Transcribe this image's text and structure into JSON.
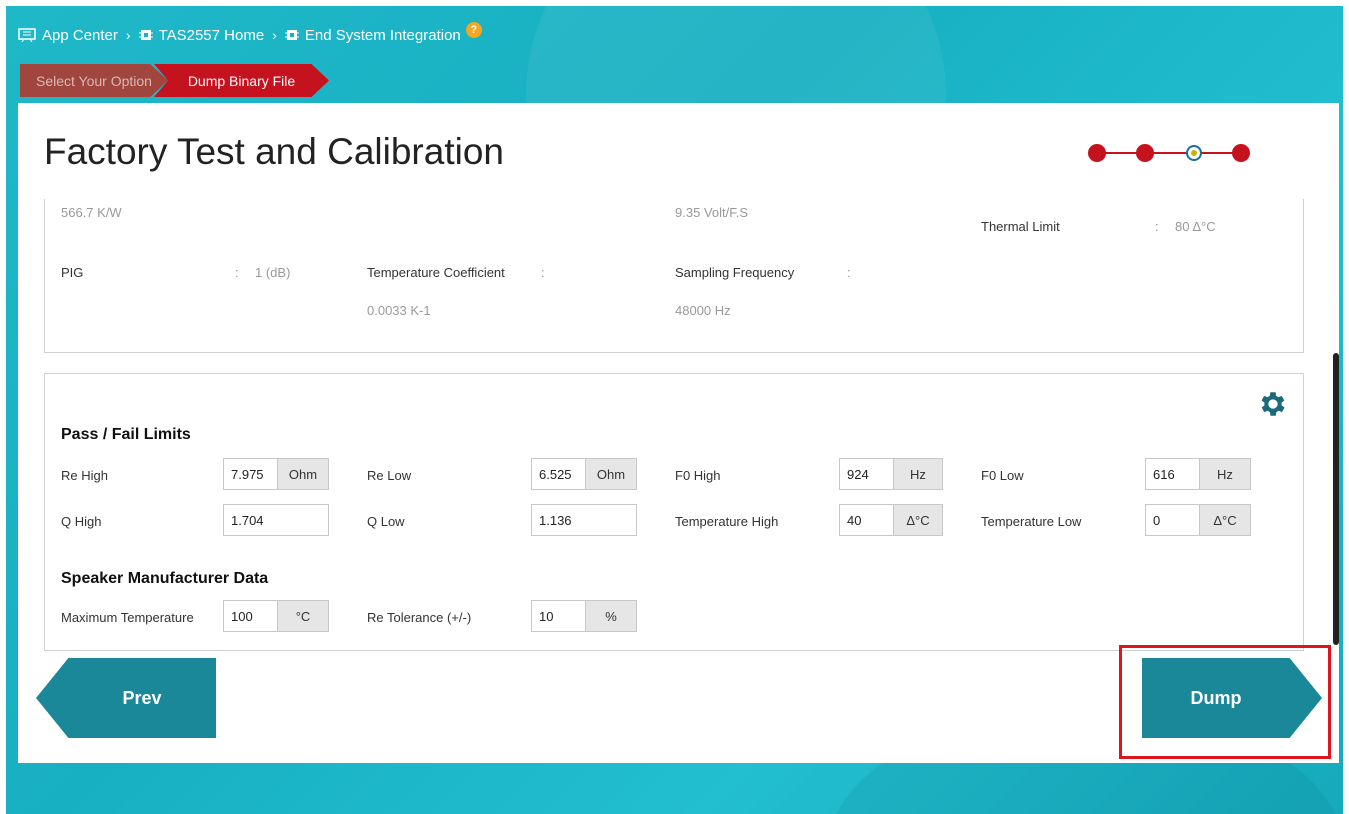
{
  "breadcrumb": {
    "items": [
      "App Center",
      "TAS2557 Home",
      "End System Integration"
    ],
    "separator": "›",
    "help_icon": "?"
  },
  "steps": [
    "Select Your Option",
    "Dump Binary File"
  ],
  "page_title": "Factory Test and Calibration",
  "progress": {
    "total": 4,
    "current": 3
  },
  "info_card": {
    "value_1": "566.7 K/W",
    "value_2": "9.35 Volt/F.S",
    "thermal_limit_label": "Thermal Limit",
    "thermal_limit_colon": ":",
    "thermal_limit_value": "80 Δ°C",
    "pig_label": "PIG",
    "pig_colon": ":",
    "pig_value": "1 (dB)",
    "temp_coeff_label": "Temperature Coefficient",
    "temp_coeff_colon": ":",
    "temp_coeff_value": "0.0033 K-1",
    "sampling_label": "Sampling Frequency",
    "sampling_colon": ":",
    "sampling_value": "48000 Hz"
  },
  "limits": {
    "title": "Pass / Fail Limits",
    "re_high": {
      "label": "Re High",
      "value": "7.975",
      "unit": "Ohm"
    },
    "re_low": {
      "label": "Re Low",
      "value": "6.525",
      "unit": "Ohm"
    },
    "f0_high": {
      "label": "F0 High",
      "value": "924",
      "unit": "Hz"
    },
    "f0_low": {
      "label": "F0 Low",
      "value": "616",
      "unit": "Hz"
    },
    "q_high": {
      "label": "Q High",
      "value": "1.704"
    },
    "q_low": {
      "label": "Q Low",
      "value": "1.136"
    },
    "temp_high": {
      "label": "Temperature High",
      "value": "40",
      "unit": "Δ°C"
    },
    "temp_low": {
      "label": "Temperature Low",
      "value": "0",
      "unit": "Δ°C"
    }
  },
  "manufacturer": {
    "title": "Speaker Manufacturer Data",
    "max_temp": {
      "label": "Maximum Temperature",
      "value": "100",
      "unit": "°C"
    },
    "re_tol": {
      "label": "Re Tolerance (+/-)",
      "value": "10",
      "unit": "%"
    }
  },
  "buttons": {
    "prev": "Prev",
    "dump": "Dump"
  },
  "colors": {
    "accent_red": "#c5121f",
    "teal_button": "#1a8899",
    "background_teal": "#1fb8c9",
    "highlight_box": "#e0141e"
  }
}
